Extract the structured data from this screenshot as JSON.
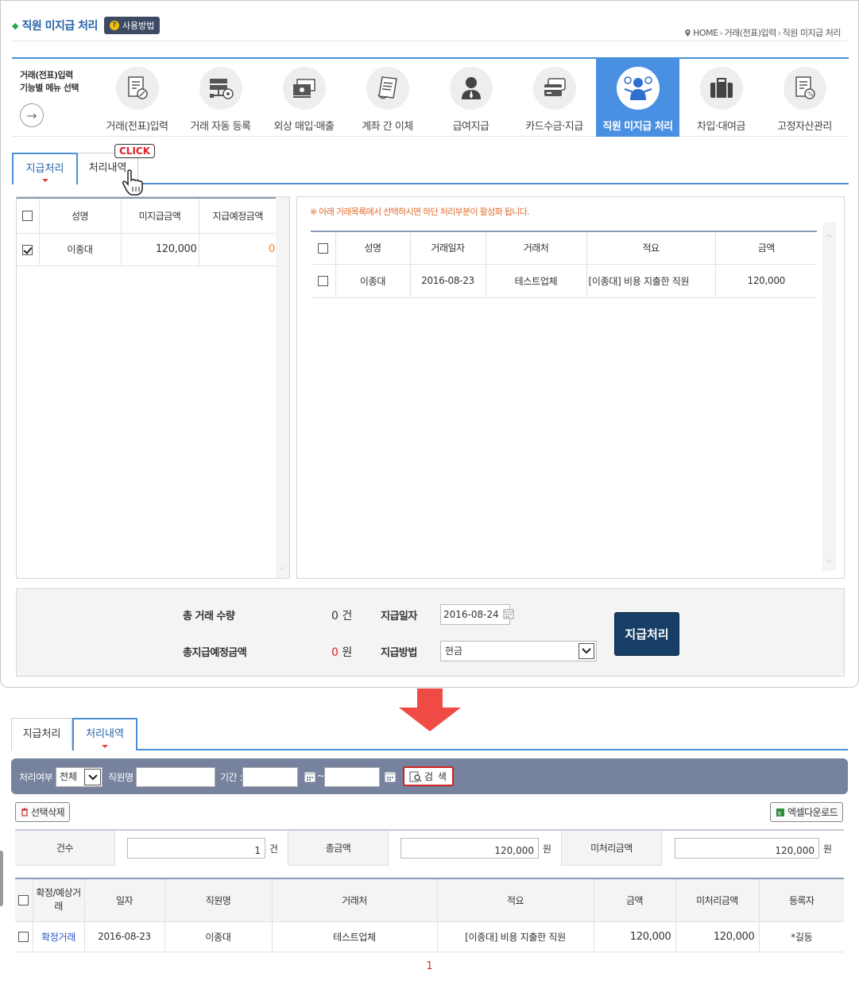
{
  "header": {
    "title": "직원 미지급 처리",
    "howto_label": "사용방법",
    "breadcrumb": [
      "HOME",
      "거래(전표)입력",
      "직원 미지급 처리"
    ]
  },
  "menu": {
    "caption_line1": "거래(전표)입력",
    "caption_line2": "기능별 메뉴 선택",
    "items": [
      {
        "label": "거래(전표)입력",
        "icon": "voucher-edit-icon"
      },
      {
        "label": "거래 자동 등록",
        "icon": "auto-register-icon"
      },
      {
        "label": "외상 매입·매출",
        "icon": "credit-trade-icon"
      },
      {
        "label": "계좌 간 이체",
        "icon": "transfer-icon"
      },
      {
        "label": "급여지급",
        "icon": "salary-icon"
      },
      {
        "label": "카드수금·지급",
        "icon": "card-icon"
      },
      {
        "label": "직원 미지급 처리",
        "icon": "employee-unpaid-icon",
        "active": true
      },
      {
        "label": "차입·대여금",
        "icon": "briefcase-icon"
      },
      {
        "label": "고정자산관리",
        "icon": "fixed-asset-icon"
      }
    ],
    "accent_color": "#4a90e2"
  },
  "tabs": {
    "pay": "지급처리",
    "history": "처리내역",
    "click_label": "CLICK"
  },
  "left_grid": {
    "headers": [
      "성명",
      "미지급금액",
      "지급예정금액"
    ],
    "rows": [
      {
        "checked": true,
        "name": "이종대",
        "unpaid": "120,000",
        "planned": "0"
      }
    ]
  },
  "right_panel": {
    "notice": "※ 아래 거래목록에서 선택하시면 하단 처리부분이 활성화 됩니다.",
    "headers": [
      "성명",
      "거래일자",
      "거래처",
      "적요",
      "금액"
    ],
    "rows": [
      {
        "checked": false,
        "name": "이종대",
        "date": "2016-08-23",
        "client": "테스트업체",
        "memo": "[이종대] 비용 지출한 직원",
        "amount": "120,000"
      }
    ]
  },
  "summary": {
    "total_count_label": "총 거래 수량",
    "total_count_value": "0",
    "total_count_unit": "건",
    "total_amount_label": "총지급예정금액",
    "total_amount_value": "0",
    "total_amount_unit": "원",
    "pay_date_label": "지급일자",
    "pay_date_value": "2016-08-24",
    "pay_method_label": "지급방법",
    "pay_method_value": "현금",
    "pay_button": "지급처리"
  },
  "search": {
    "status_label": "처리여부 :",
    "status_value": "전체",
    "employee_label": "직원명 :",
    "employee_value": "",
    "period_label": "기간 :",
    "period_from": "",
    "period_to": "",
    "tilde": "~",
    "search_button": "검 색"
  },
  "actions": {
    "delete_selected": "선택삭제",
    "excel_download": "엑셀다운로드"
  },
  "stats": {
    "count_label": "건수",
    "count_value": "1",
    "count_unit": "건",
    "total_label": "총금액",
    "total_value": "120,000",
    "total_unit": "원",
    "unprocessed_label": "미처리금액",
    "unprocessed_value": "120,000",
    "unprocessed_unit": "원"
  },
  "history_grid": {
    "headers": [
      "확정/예상거래",
      "일자",
      "직원명",
      "거래처",
      "적요",
      "금액",
      "미처리금액",
      "등록자"
    ],
    "rows": [
      {
        "checked": false,
        "status": "확정거래",
        "date": "2016-08-23",
        "employee": "이종대",
        "client": "테스트업체",
        "memo": "[이종대] 비용 지출한 직원",
        "amount": "120,000",
        "unprocessed": "120,000",
        "registrant": "*길동"
      }
    ]
  },
  "pagination": {
    "current": "1"
  }
}
